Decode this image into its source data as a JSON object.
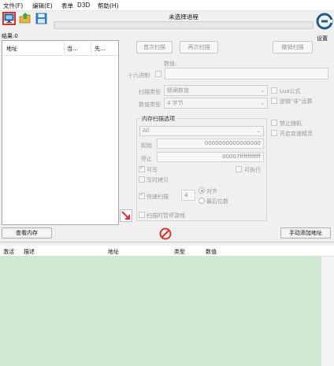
{
  "menu": {
    "items": [
      {
        "key": "file",
        "label": "文件(F)"
      },
      {
        "key": "edit",
        "label": "编辑(E)"
      },
      {
        "key": "table",
        "label": "表单"
      },
      {
        "key": "d3d",
        "label": "D3D"
      },
      {
        "key": "help",
        "label": "帮助(H)"
      }
    ]
  },
  "process": {
    "title": "未选择进程"
  },
  "settings": {
    "label": "设置"
  },
  "results": {
    "count_label": "结果:0",
    "columns": [
      "地址",
      "当...",
      "先..."
    ]
  },
  "scan_buttons": {
    "first_scan": "首次扫描",
    "next_scan": "再次扫描",
    "undo_scan": "撤销扫描"
  },
  "value": {
    "label": "数值:",
    "hex_label": "十六进制"
  },
  "scan_type": {
    "label": "扫描类型",
    "selected": "精确数值"
  },
  "value_type": {
    "label": "数值类型",
    "selected": "4 字节"
  },
  "options_right": {
    "lua": "Lua公式",
    "logic_not": "逻辑\"非\"运算",
    "disable_random": "禁止随机",
    "speedhack": "开启变速精灵"
  },
  "memory": {
    "title": "内存扫描选项",
    "region": "All",
    "start_label": "起始",
    "start_value": "0000000000000000",
    "stop_label": "停止",
    "stop_value": "00007fffffffffff",
    "writable": "可写",
    "executable": "可执行",
    "copy_on_write": "写时拷贝",
    "fast_scan": "快速扫描",
    "fast_scan_value": "4",
    "align": "对齐",
    "last_digits": "最后位数",
    "pause_game": "扫描时暂停游戏"
  },
  "bottom_buttons": {
    "view_memory": "查看内存",
    "add_address": "手动添加地址"
  },
  "address_list": {
    "columns": [
      "激活",
      "描述",
      "地址",
      "类型",
      "数值"
    ]
  },
  "colors": {
    "accent_red": "#d9342b",
    "list_green": "#cfe8d2",
    "logo_blue": "#1f5f8b"
  }
}
